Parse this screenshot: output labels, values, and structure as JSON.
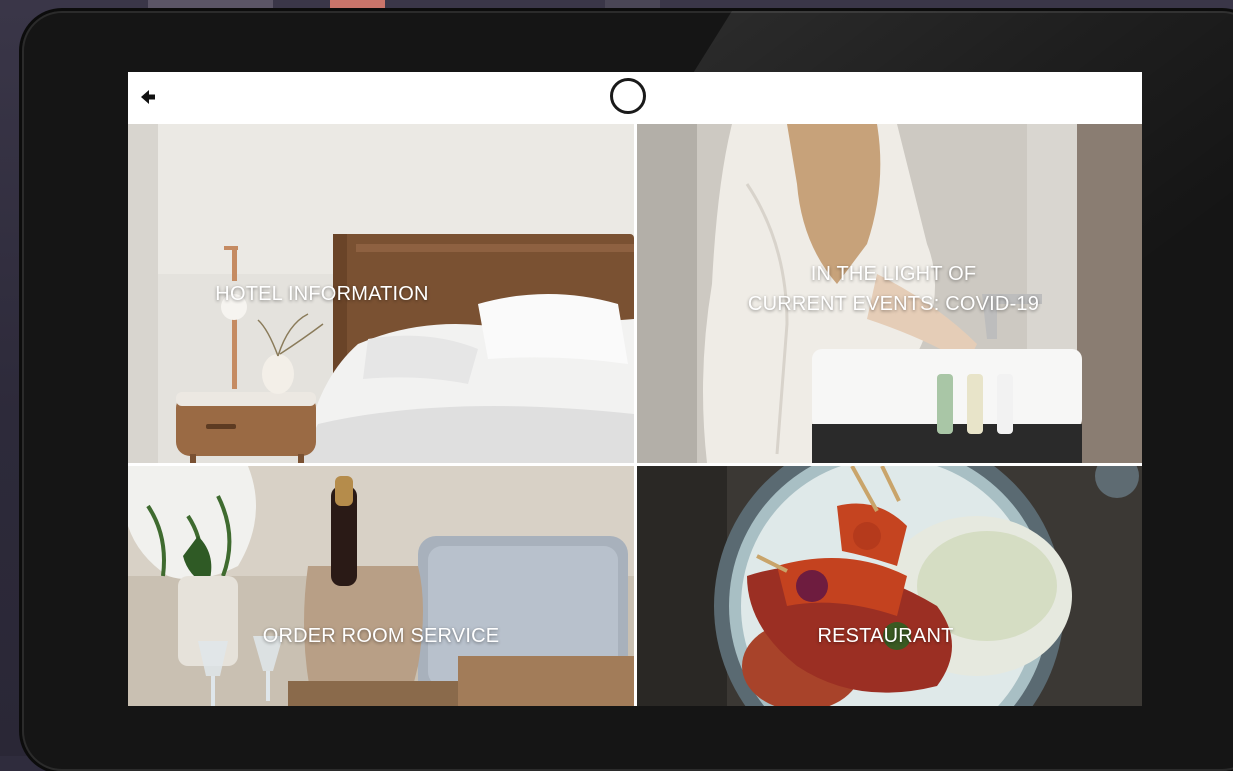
{
  "header": {
    "back_icon": "arrow-left-icon",
    "logo_icon": "circle-logo-icon"
  },
  "tiles": [
    {
      "label_lines": [
        "HOTEL INFORMATION"
      ]
    },
    {
      "label_lines": [
        "IN THE LIGHT OF",
        "CURRENT EVENTS: COVID-19"
      ]
    },
    {
      "label_lines": [
        "ORDER ROOM SERVICE"
      ]
    },
    {
      "label_lines": [
        "RESTAURANT"
      ]
    }
  ],
  "colors": {
    "background": "#2f2c3d",
    "bezel": "#151515",
    "label": "#ffffff"
  }
}
